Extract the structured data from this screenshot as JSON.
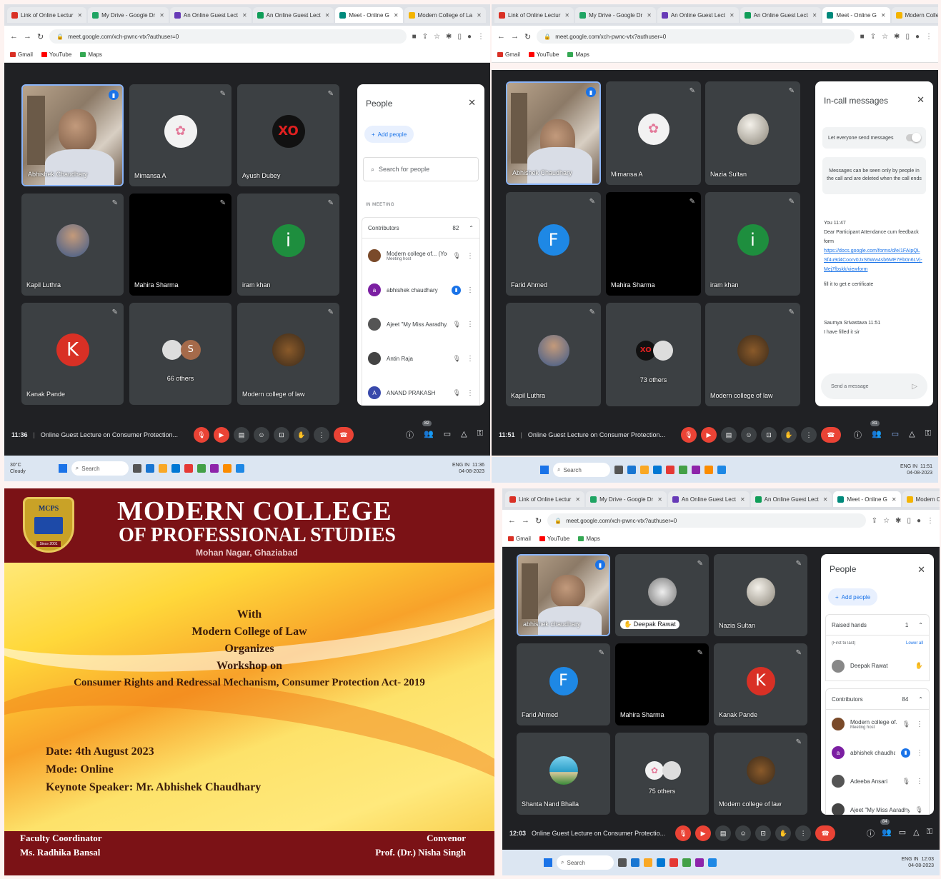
{
  "browser": {
    "tabs": [
      "Link of Online Lectur",
      "My Drive - Google Dr",
      "An Online Guest Lect",
      "An Online Guest Lect",
      "Meet - Online G",
      "Modern College of La"
    ],
    "url": "meet.google.com/xch-pwnc-vtx?authuser=0",
    "bookmarks": [
      "Gmail",
      "YouTube",
      "Maps"
    ]
  },
  "q1": {
    "tiles": [
      "Abhishek Chaudhary",
      "Mimansa A",
      "Ayush Dubey",
      "Kapil Luthra",
      "Mahira Sharma",
      "iram khan",
      "Kanak Pande",
      "66 others",
      "Modern college of law"
    ],
    "avatar_letters": {
      "iram": "i",
      "kanak": "K",
      "others": "S"
    },
    "time": "11:36",
    "meeting_title": "Online Guest Lecture on Consumer Protection...",
    "people_count": "82",
    "panel": {
      "title": "People",
      "add": "Add people",
      "search": "Search for people",
      "section": "IN MEETING",
      "group": "Contributors",
      "group_count": "82",
      "rows": [
        {
          "name": "Modern college of... (You)",
          "sub": "Meeting host"
        },
        {
          "name": "abhishek chaudhary",
          "sub": ""
        },
        {
          "name": "Ajeet \"My Miss Aaradhy...",
          "sub": ""
        },
        {
          "name": "Antin Raja",
          "sub": ""
        },
        {
          "name": "ANAND PRAKASH",
          "sub": ""
        }
      ]
    },
    "weather": {
      "temp": "30°C",
      "cond": "Cloudy"
    },
    "taskbar_search": "Search",
    "lang": "ENG IN",
    "clock_time": "11:36",
    "clock_date": "04-08-2023"
  },
  "q2": {
    "tiles": [
      "Abhishek Chaudhary",
      "Mimansa A",
      "Nazia Sultan",
      "Farid Ahmed",
      "Mahira Sharma",
      "iram khan",
      "Kapil Luthra",
      "73 others",
      "Modern college of law"
    ],
    "avatar_letters": {
      "farid": "F",
      "iram": "i"
    },
    "time": "11:51",
    "meeting_title": "Online Guest Lecture on Consumer Protection...",
    "people_count": "81",
    "chat": {
      "title": "In-call messages",
      "toggle": "Let everyone send messages",
      "note": "Messages can be seen only by people in the call and are deleted when the call ends",
      "sender": "You  11:47",
      "msg": "Dear Participant Attendance cum feedback form",
      "link": "https://docs.google.com/forms/d/e/1FAIpQLSf4u9d4Coorv0JxS6Ww4sb6ME7Eb0n6LVj-Mej7fbskk/viewform",
      "msg2": "fill it to get e certificate",
      "sender2": "Saumya Srivastava  11:51",
      "msg3": "I have filled it sir",
      "placeholder": "Send a message"
    },
    "taskbar_search": "Search",
    "lang": "ENG IN",
    "clock_time": "11:51",
    "clock_date": "04-08-2023"
  },
  "q3": {
    "logo": "MCPS",
    "logo_since": "Since 2001",
    "title1": "MODERN COLLEGE",
    "title2": "OF PROFESSIONAL STUDIES",
    "location": "Mohan Nagar, Ghaziabad",
    "lines": [
      "With",
      "Modern College of Law",
      "Organizes",
      "Workshop on",
      "Consumer Rights and Redressal Mechanism, Consumer Protection Act- 2019"
    ],
    "date": "Date: 4th August 2023",
    "mode": "Mode: Online",
    "speaker": "Keynote Speaker: Mr. Abhishek Chaudhary",
    "fc_label": "Faculty Coordinator",
    "fc_name": "Ms. Radhika Bansal",
    "conv_label": "Convenor",
    "conv_name": "Prof. (Dr.) Nisha Singh"
  },
  "q4": {
    "tiles": [
      "abhishek chaudhary",
      "Deepak Rawat",
      "Nazia Sultan",
      "Farid Ahmed",
      "Mahira Sharma",
      "Kanak Pande",
      "Shanta Nand Bhalla",
      "75 others",
      "Modern college of law"
    ],
    "avatar_letters": {
      "farid": "F",
      "kanak": "K"
    },
    "time": "12:03",
    "meeting_title": "Online Guest Lecture on Consumer Protectio...",
    "people_count": "84",
    "panel": {
      "title": "People",
      "add": "Add people",
      "raised": "Raised hands",
      "raised_count": "1",
      "first": "(First to last)",
      "lower_all": "Lower all",
      "raised_name": "Deepak Rawat",
      "group": "Contributors",
      "group_count": "84",
      "rows": [
        {
          "name": "Modern college of... (You)",
          "sub": "Meeting host"
        },
        {
          "name": "abhishek chaudhary",
          "sub": ""
        },
        {
          "name": "Adeeba Ansari",
          "sub": ""
        },
        {
          "name": "Ajeet \"My Miss Aaradhy...",
          "sub": ""
        }
      ]
    },
    "taskbar_search": "Search",
    "lang": "ENG IN",
    "clock_time": "12:03",
    "clock_date": "04-08-2023"
  }
}
